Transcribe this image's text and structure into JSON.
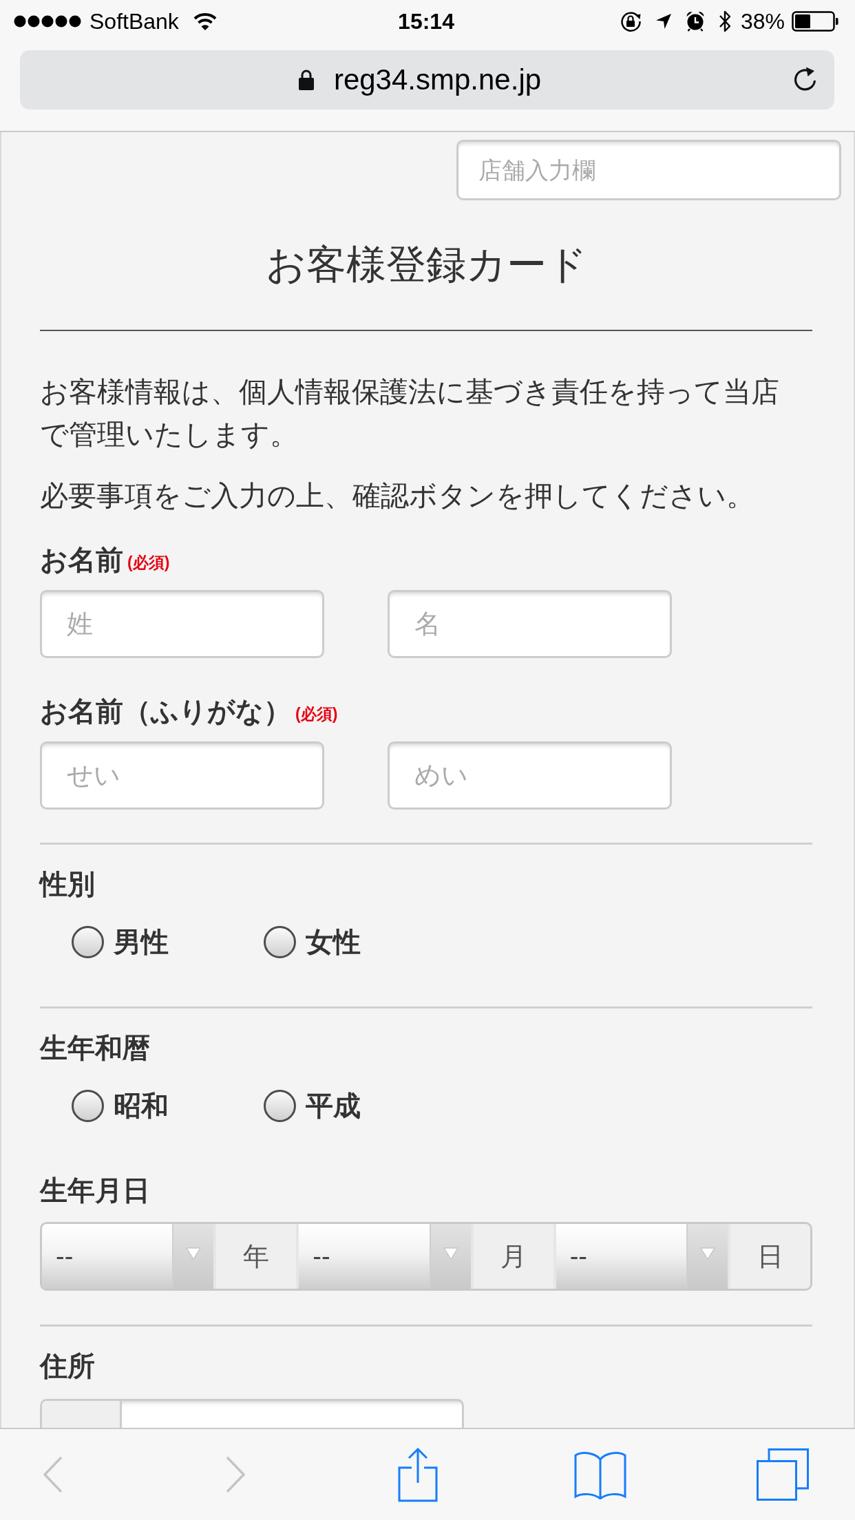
{
  "status_bar": {
    "carrier": "SoftBank",
    "time": "15:14",
    "battery": "38%"
  },
  "address_bar": {
    "url": "reg34.smp.ne.jp"
  },
  "page": {
    "store_field": {
      "placeholder": "店舗入力欄"
    },
    "title": "お客様登録カード",
    "paragraphs": [
      "お客様情報は、個人情報保護法に基づき責任を持って当店で管理いたします。",
      "必要事項をご入力の上、確認ボタンを押してください。"
    ],
    "form": [
      {
        "kind": "name_pair",
        "label": "お名前",
        "required": "(必須)",
        "fields": [
          {
            "placeholder": "姓"
          },
          {
            "placeholder": "名"
          }
        ]
      },
      {
        "kind": "name_pair",
        "label": "お名前（ふりがな）",
        "required": "(必須)",
        "fields": [
          {
            "placeholder": "せい"
          },
          {
            "placeholder": "めい"
          }
        ]
      },
      {
        "kind": "divider"
      },
      {
        "kind": "radio",
        "label": "性別",
        "options": [
          {
            "label": "男性",
            "selected": false
          },
          {
            "label": "女性",
            "selected": false
          }
        ]
      },
      {
        "kind": "divider"
      },
      {
        "kind": "radio",
        "label": "生年和暦",
        "options": [
          {
            "label": "昭和",
            "selected": false
          },
          {
            "label": "平成",
            "selected": false
          }
        ]
      },
      {
        "kind": "date",
        "label": "生年月日",
        "parts": [
          {
            "value": "--",
            "unit": "年"
          },
          {
            "value": "--",
            "unit": "月"
          },
          {
            "value": "--",
            "unit": "日"
          }
        ]
      },
      {
        "kind": "divider"
      },
      {
        "kind": "postal",
        "label": "住所"
      }
    ]
  },
  "toolbar": {
    "buttons": [
      {
        "kind": "back",
        "disabled": true
      },
      {
        "kind": "forward",
        "disabled": true
      },
      {
        "kind": "share",
        "disabled": false
      },
      {
        "kind": "bookmarks",
        "disabled": false
      },
      {
        "kind": "tabs",
        "disabled": false
      }
    ]
  }
}
